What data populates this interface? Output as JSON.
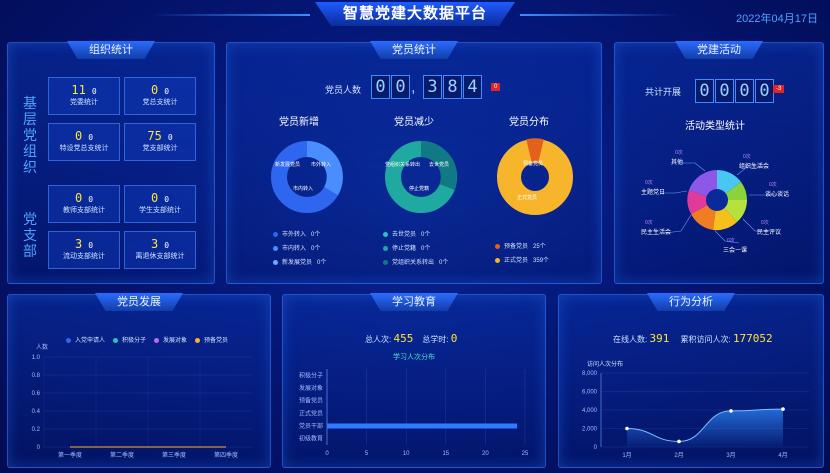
{
  "header": {
    "title": "智慧党建大数据平台",
    "date": "2022年04月17日"
  },
  "org": {
    "title": "组织统计",
    "group1_label": "基层党组织",
    "group2_label": "党支部",
    "items": [
      {
        "num": "11",
        "unit": "0",
        "label": "党委统计"
      },
      {
        "num": "0",
        "unit": "0",
        "label": "党总支统计"
      },
      {
        "num": "0",
        "unit": "0",
        "label": "特设党总支统计"
      },
      {
        "num": "75",
        "unit": "0",
        "label": "党支部统计"
      },
      {
        "num": "0",
        "unit": "0",
        "label": "教师支部统计"
      },
      {
        "num": "0",
        "unit": "0",
        "label": "学生支部统计"
      },
      {
        "num": "3",
        "unit": "0",
        "label": "流动支部统计"
      },
      {
        "num": "3",
        "unit": "0",
        "label": "离退休支部统计"
      }
    ]
  },
  "members": {
    "title": "党员统计",
    "count_label": "党员人数",
    "digits": [
      "0",
      "0",
      ",",
      "3",
      "8",
      "4"
    ],
    "badge": "0",
    "add": {
      "title": "党员新增",
      "labels": [
        "新发展党员",
        "市外转入",
        "市内转入"
      ],
      "legend": [
        {
          "label": "市外转入",
          "value": "0个"
        },
        {
          "label": "市内转入",
          "value": "0个"
        },
        {
          "label": "新发展党员",
          "value": "0个"
        }
      ]
    },
    "reduce": {
      "title": "党员减少",
      "labels": [
        "党组织关系转出",
        "去世党员",
        "停止党籍"
      ],
      "legend": [
        {
          "label": "去世党员",
          "value": "0个"
        },
        {
          "label": "停止党籍",
          "value": "0个"
        },
        {
          "label": "党组织关系转出",
          "value": "0个"
        }
      ]
    },
    "dist": {
      "title": "党员分布",
      "labels": [
        "预备党员",
        "正式党员"
      ],
      "legend": [
        {
          "label": "预备党员",
          "value": "25个"
        },
        {
          "label": "正式党员",
          "value": "359个"
        }
      ]
    }
  },
  "activity": {
    "title": "党建活动",
    "total_label": "共计开展",
    "digits": [
      "0",
      "0",
      "0",
      "0"
    ],
    "badge": "-3",
    "chart_title": "活动类型统计",
    "types": [
      {
        "count": "0次",
        "name": "其他"
      },
      {
        "count": "0次",
        "name": "组织生活会"
      },
      {
        "count": "0次",
        "name": "谈心谈话"
      },
      {
        "count": "0次",
        "name": "民主评议"
      },
      {
        "count": "0次",
        "name": "三会一课"
      },
      {
        "count": "0次",
        "name": "民主生活会"
      },
      {
        "count": "0次",
        "name": "主题党日"
      }
    ]
  },
  "develop": {
    "title": "党员发展",
    "ylabel": "人数"
  },
  "study": {
    "title": "学习教育",
    "total_label": "总人次:",
    "total": "455",
    "hours_label": "总学时:",
    "hours": "0",
    "chart_title": "学习人次分布"
  },
  "behavior": {
    "title": "行为分析",
    "online_label": "在线人数:",
    "online": "391",
    "visits_label": "累积访问人次:",
    "visits": "177052",
    "chart_title": "访问人次分布"
  },
  "colors": {
    "accent": "#ffe23c",
    "blue": "#3f8cff"
  },
  "chart_data": [
    {
      "type": "line",
      "title": "",
      "ylabel": "人数",
      "categories": [
        "第一季度",
        "第二季度",
        "第三季度",
        "第四季度"
      ],
      "series": [
        {
          "name": "入党申请人",
          "values": [
            0,
            0,
            0,
            0
          ]
        },
        {
          "name": "积极分子",
          "values": [
            0,
            0,
            0,
            0
          ]
        },
        {
          "name": "发展对象",
          "values": [
            0,
            0,
            0,
            0
          ]
        },
        {
          "name": "预备党员",
          "values": [
            0,
            0,
            0,
            0
          ]
        }
      ],
      "yticks": [
        "0",
        "0.2",
        "0.4",
        "0.6",
        "0.8",
        "1.0"
      ],
      "ylim": [
        0,
        1
      ]
    },
    {
      "type": "bar",
      "orientation": "horizontal",
      "categories": [
        "积极分子",
        "发展对象",
        "预备党员",
        "正式党员",
        "党员干部",
        "初级教育"
      ],
      "values": [
        0,
        0,
        0,
        0,
        0,
        0
      ],
      "special": {
        "category": "党员干部",
        "value": 24
      },
      "xticks": [
        "0",
        "5",
        "10",
        "15",
        "20",
        "25"
      ],
      "xlim": [
        0,
        25
      ]
    },
    {
      "type": "area",
      "categories": [
        "1月",
        "2月",
        "3月",
        "4月"
      ],
      "values": [
        2000,
        600,
        3900,
        4100
      ],
      "yticks": [
        "0",
        "2,000",
        "4,000",
        "6,000",
        "8,000"
      ],
      "ylim": [
        0,
        8000
      ]
    }
  ]
}
